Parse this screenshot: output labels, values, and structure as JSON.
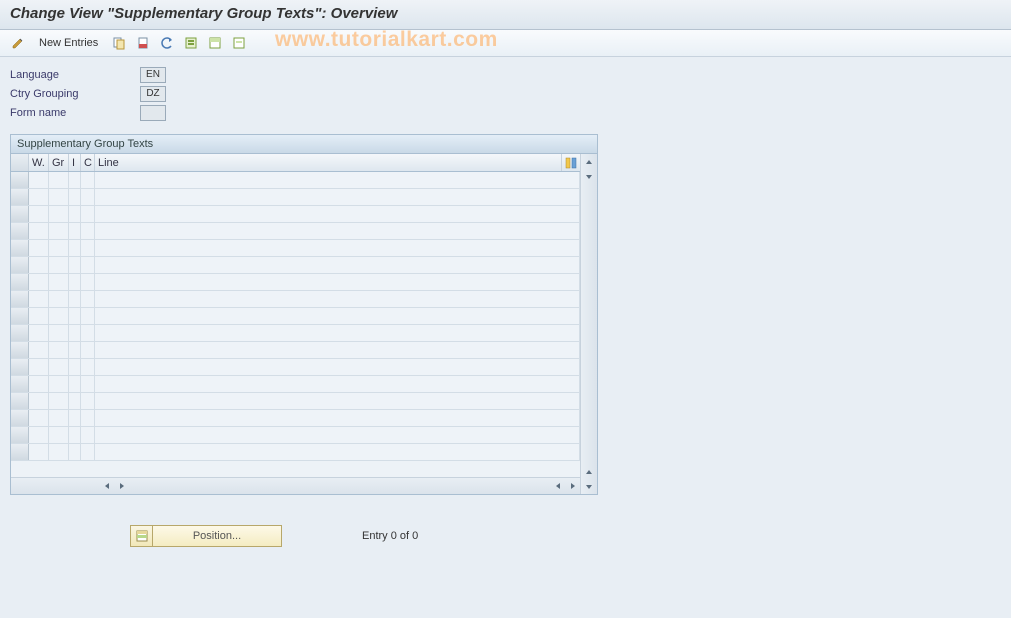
{
  "title": "Change View \"Supplementary Group Texts\": Overview",
  "toolbar": {
    "new_entries_label": "New Entries"
  },
  "watermark": "www.tutorialkart.com",
  "form": {
    "language_label": "Language",
    "language_value": "EN",
    "ctry_grouping_label": "Ctry Grouping",
    "ctry_grouping_value": "DZ",
    "form_name_label": "Form name",
    "form_name_value": ""
  },
  "grid": {
    "title": "Supplementary Group Texts",
    "columns": {
      "w": "W.",
      "gr": "Gr",
      "i": "I",
      "c": "C",
      "line": "Line"
    },
    "rows": [
      {},
      {},
      {},
      {},
      {},
      {},
      {},
      {},
      {},
      {},
      {},
      {},
      {},
      {},
      {},
      {},
      {}
    ]
  },
  "footer": {
    "position_label": "Position...",
    "entry_info": "Entry 0 of 0"
  }
}
